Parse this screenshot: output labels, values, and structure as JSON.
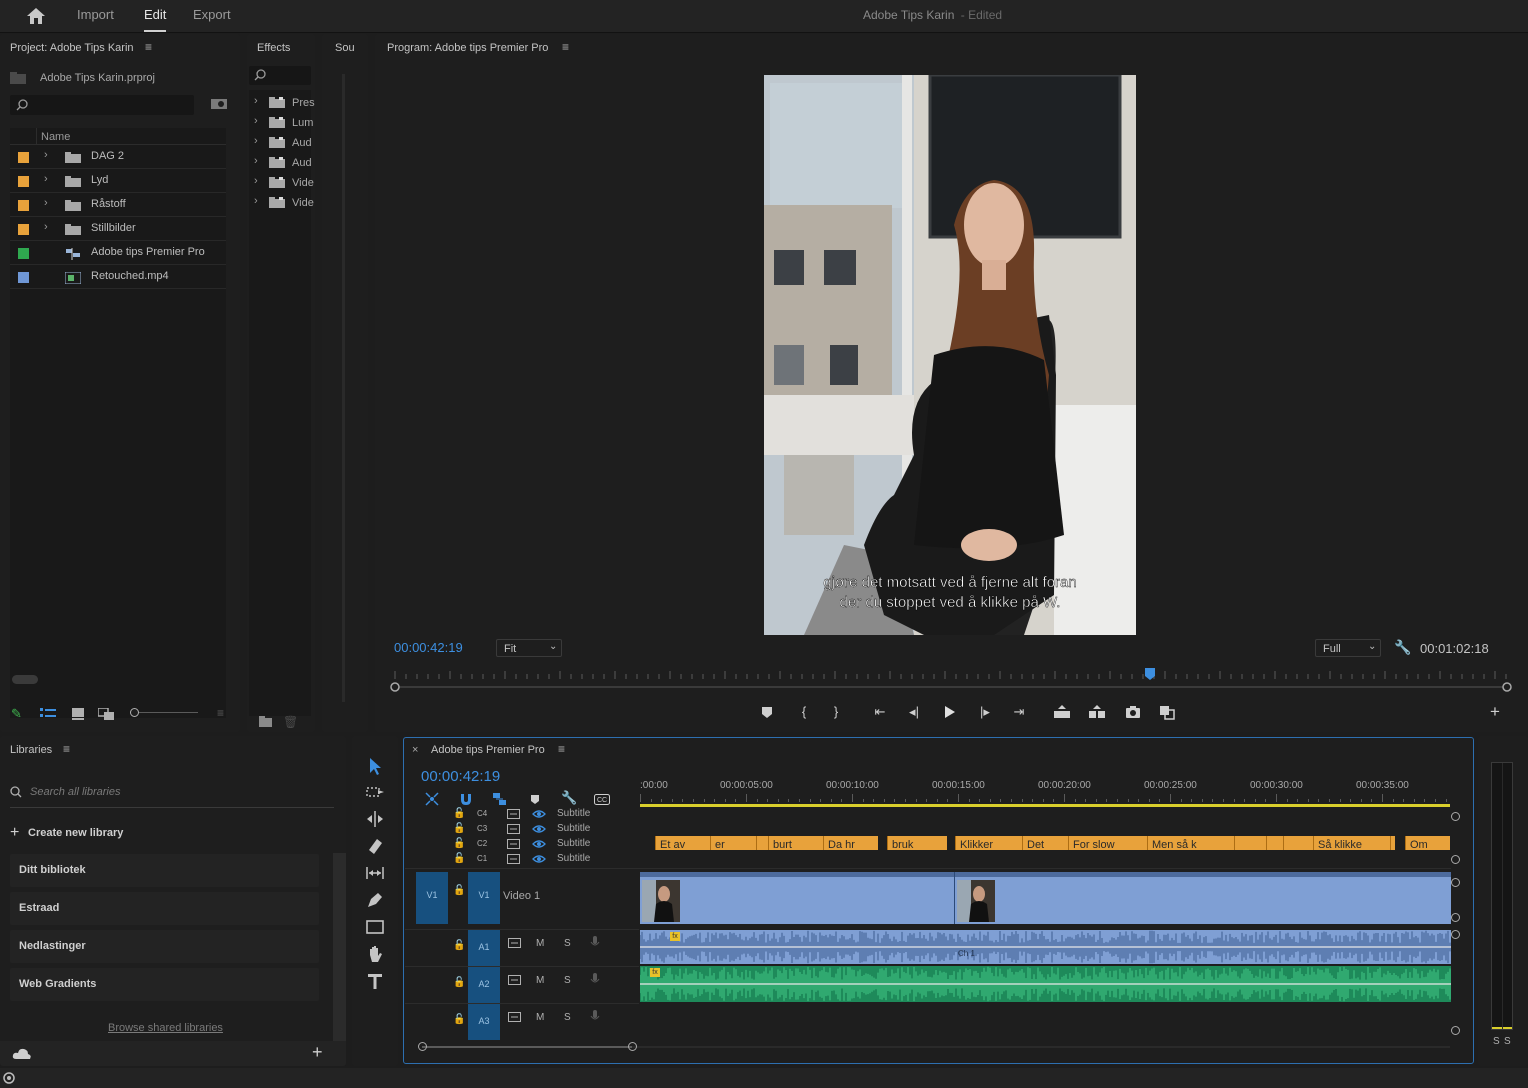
{
  "app": {
    "title": "Adobe Tips Karin",
    "title_status": "- Edited",
    "nav": [
      "Import",
      "Edit",
      "Export"
    ],
    "active_nav": "Edit",
    "accent": "#2d8ceb"
  },
  "project": {
    "title": "Project: Adobe Tips Karin",
    "file": "Adobe Tips Karin.prproj",
    "column_name": "Name",
    "items": [
      {
        "name": "DAG 2",
        "type": "folder",
        "color": "#e8a23b"
      },
      {
        "name": "Lyd",
        "type": "folder",
        "color": "#e8a23b"
      },
      {
        "name": "Råstoff",
        "type": "folder",
        "color": "#e8a23b"
      },
      {
        "name": "Stillbilder",
        "type": "folder",
        "color": "#e8a23b"
      },
      {
        "name": "Adobe tips Premier Pro",
        "type": "sequence",
        "color": "#2fa84f"
      },
      {
        "name": "Retouched.mp4",
        "type": "video",
        "color": "#6f97d6"
      }
    ]
  },
  "effects": {
    "title": "Effects",
    "items": [
      "Pres",
      "Lum",
      "Aud",
      "Aud",
      "Vide",
      "Vide"
    ]
  },
  "source": {
    "title": "Sou"
  },
  "program": {
    "title": "Program: Adobe tips Premier Pro",
    "timecode": "00:00:42:19",
    "fit": "Fit",
    "quality": "Full",
    "duration": "00:01:02:18",
    "subtitle_line1": "gjøre det motsatt ved å fjerne alt foran",
    "subtitle_line2": "der du stoppet ved å klikke på W."
  },
  "libraries": {
    "title": "Libraries",
    "search_placeholder": "Search all libraries",
    "create": "Create new library",
    "items": [
      "Ditt bibliotek",
      "Estraad",
      "Nedlastinger",
      "Web Gradients"
    ],
    "browse": "Browse shared libraries"
  },
  "timeline": {
    "title": "Adobe tips Premier Pro",
    "timecode": "00:00:42:19",
    "ruler": [
      ":00:00",
      "00:00:05:00",
      "00:00:10:00",
      "00:00:15:00",
      "00:00:20:00",
      "00:00:25:00",
      "00:00:30:00",
      "00:00:35:00"
    ],
    "subtitle_tracks": [
      {
        "id": "C4",
        "label": "Subtitle"
      },
      {
        "id": "C3",
        "label": "Subtitle"
      },
      {
        "id": "C2",
        "label": "Subtitle"
      },
      {
        "id": "C1",
        "label": "Subtitle"
      }
    ],
    "captions": [
      "Et av",
      "er",
      "",
      "burt",
      "Da hr",
      "bruk",
      "Klikker",
      "Det",
      "For slow",
      "Men så k",
      "",
      "",
      "",
      "Så klikke",
      "",
      "Om"
    ],
    "video_track": {
      "button": "V1",
      "target": "V1",
      "name": "Video 1"
    },
    "audio_tracks": [
      {
        "id": "A1",
        "mute": "M",
        "solo": "S"
      },
      {
        "id": "A2",
        "mute": "M",
        "solo": "S"
      },
      {
        "id": "A3",
        "mute": "M",
        "solo": "S"
      }
    ],
    "clip_label": "Ch 1"
  },
  "meter": {
    "labels": [
      "S",
      "S"
    ]
  }
}
